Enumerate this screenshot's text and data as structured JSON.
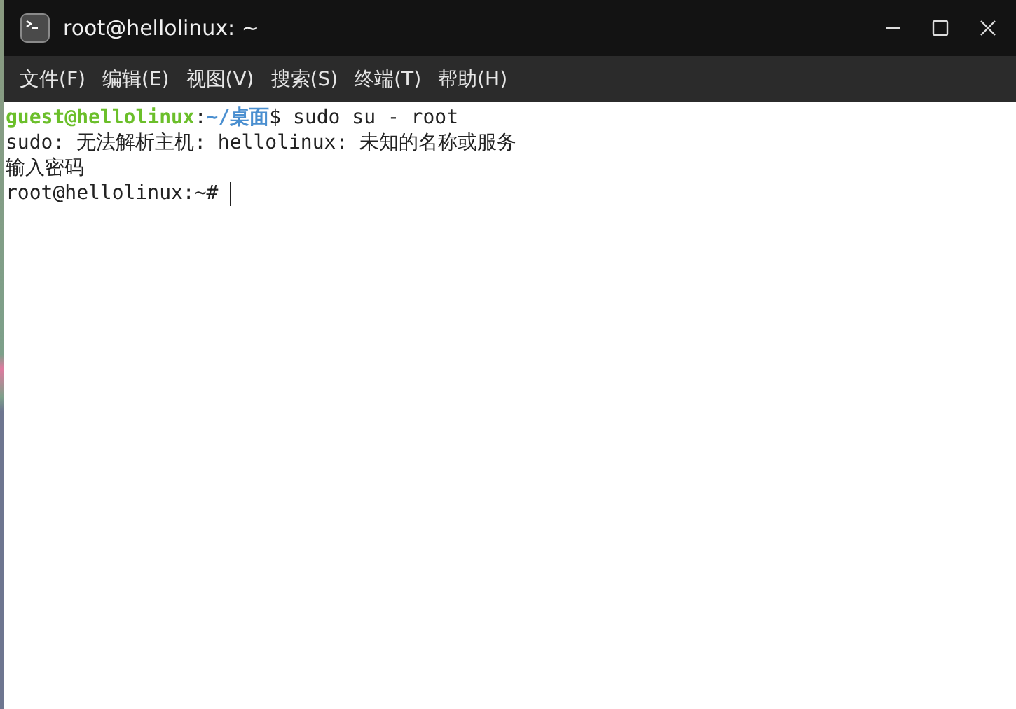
{
  "window": {
    "title": "root@hellolinux: ~"
  },
  "menu": [
    "文件(F)",
    "编辑(E)",
    "视图(V)",
    "搜索(S)",
    "终端(T)",
    "帮助(H)"
  ],
  "terminal": {
    "lines": [
      {
        "cursor": false,
        "segments": [
          {
            "kind": "user",
            "text": "guest@hellolinux"
          },
          {
            "kind": "plain",
            "text": ":"
          },
          {
            "kind": "path",
            "text": "~/桌面"
          },
          {
            "kind": "plain",
            "text": "$ sudo su - root"
          }
        ]
      },
      {
        "cursor": false,
        "segments": [
          {
            "kind": "plain",
            "text": "sudo: 无法解析主机: hellolinux: 未知的名称或服务"
          }
        ]
      },
      {
        "cursor": false,
        "segments": [
          {
            "kind": "plain",
            "text": "输入密码"
          }
        ]
      },
      {
        "cursor": true,
        "segments": [
          {
            "kind": "plain",
            "text": "root@hellolinux:~# "
          }
        ]
      }
    ]
  }
}
